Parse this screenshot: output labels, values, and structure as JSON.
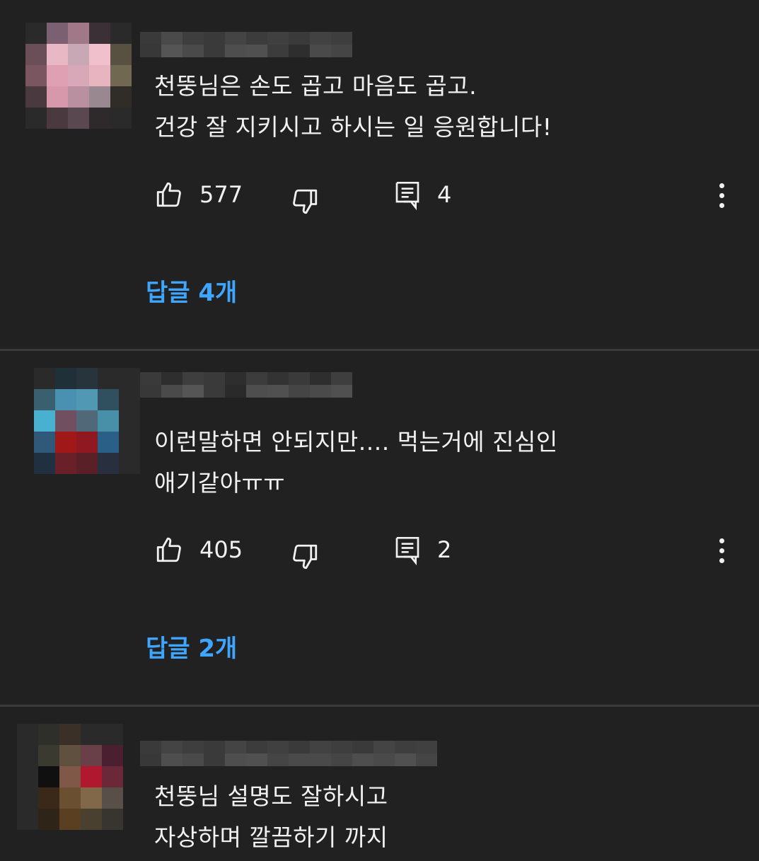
{
  "comments": [
    {
      "text": "천뚱님은 손도 곱고 마음도 곱고.\n건강 잘 지키시고 하시는 일 응원합니다!",
      "likes": "577",
      "reply_count": "4",
      "replies_link": "답글 4개"
    },
    {
      "text": "이런말하면 안되지만.... 먹는거에 진심인\n애기같아ㅠㅠ",
      "likes": "405",
      "reply_count": "2",
      "replies_link": "답글 2개"
    },
    {
      "text": "천뚱님 설명도 잘하시고\n자상하며 깔끔하기 까지"
    }
  ],
  "colors": {
    "background": "#212121",
    "divider": "#3a3a3a",
    "text": "#f1f1f1",
    "link": "#3ea6ff"
  },
  "icons": {
    "like": "thumb-up-icon",
    "dislike": "thumb-down-icon",
    "reply": "comment-icon",
    "more": "more-vert-icon"
  }
}
